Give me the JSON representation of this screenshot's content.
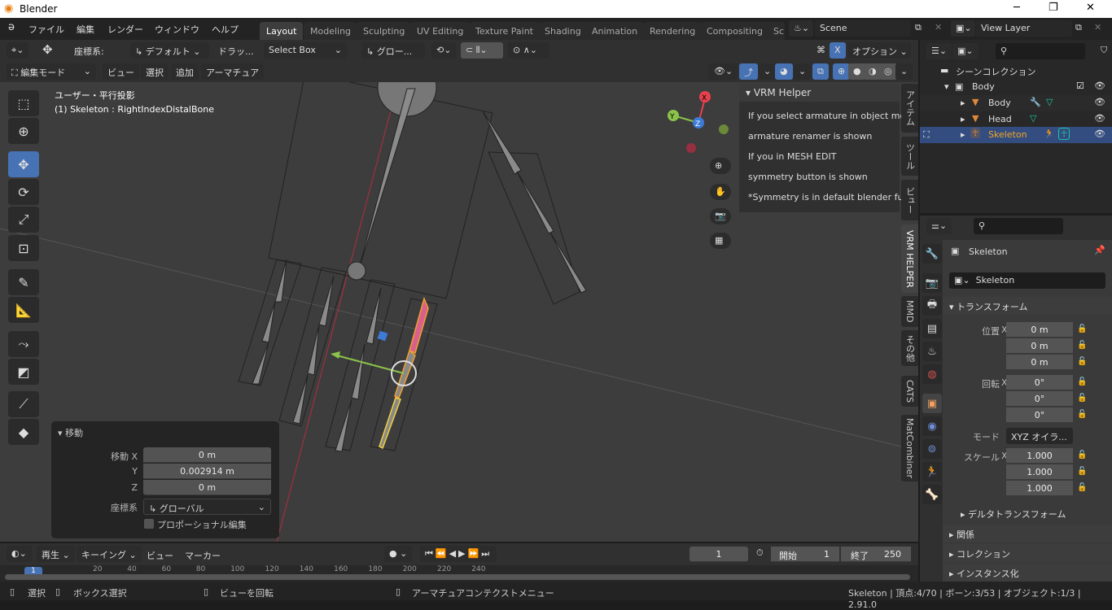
{
  "window": {
    "title": "Blender"
  },
  "menu": [
    "ファイル",
    "編集",
    "レンダー",
    "ウィンドウ",
    "ヘルプ"
  ],
  "workspaces": [
    "Layout",
    "Modeling",
    "Sculpting",
    "UV Editing",
    "Texture Paint",
    "Shading",
    "Animation",
    "Rendering",
    "Compositing",
    "Sc"
  ],
  "active_workspace": "Layout",
  "scene": "Scene",
  "view_layer": "View Layer",
  "tool_settings": {
    "coord_label": "座標系:",
    "coord_value": "デフォルト",
    "drag_label": "ドラッ...",
    "drag_value": "Select Box",
    "transform_orient": "グロー...",
    "options": "オプション",
    "mirror_x": "X"
  },
  "viewport_header": {
    "mode": "編集モード",
    "menus": [
      "ビュー",
      "選択",
      "追加",
      "アーマチュア"
    ]
  },
  "viewport": {
    "view_name": "ユーザー・平行投影",
    "object_info": "(1) Skeleton : RightIndexDistalBone",
    "gizmo_axes": [
      "X",
      "Y",
      "Z"
    ]
  },
  "vrm_helper": {
    "title": "VRM Helper",
    "lines": [
      "If you select armature in object mo...",
      "armature renamer is shown",
      "If you in MESH EDIT",
      "symmetry button is shown",
      "*Symmetry is in default blender fu..."
    ]
  },
  "n_tabs": [
    "アイテム",
    "ツール",
    "ビュー",
    "VRM HELPER",
    "MMD",
    "その他",
    "CATS",
    "MatCombiner"
  ],
  "active_n_tab": "VRM HELPER",
  "operator_panel": {
    "title": "移動",
    "fields": [
      {
        "label": "移動 X",
        "value": "0 m"
      },
      {
        "label": "Y",
        "value": "0.002914 m"
      },
      {
        "label": "Z",
        "value": "0 m"
      }
    ],
    "orient_label": "座標系",
    "orient_value": "グローバル",
    "proportional": "プロポーショナル編集",
    "proportional_checked": false
  },
  "outliner": {
    "root": "シーンコレクション",
    "items": [
      {
        "name": "Body",
        "type": "collection",
        "checked": true
      },
      {
        "name": "Body",
        "type": "mesh"
      },
      {
        "name": "Head",
        "type": "mesh"
      },
      {
        "name": "Skeleton",
        "type": "armature",
        "selected": true
      }
    ]
  },
  "properties": {
    "object_name": "Skeleton",
    "datablock": "Skeleton",
    "transform_title": "トランスフォーム",
    "location": {
      "label": "位置",
      "x": "0 m",
      "y": "0 m",
      "z": "0 m"
    },
    "rotation": {
      "label": "回転",
      "x": "0°",
      "y": "0°",
      "z": "0°"
    },
    "mode_label": "モード",
    "mode_value": "XYZ オイラ...",
    "scale": {
      "label": "スケール",
      "x": "1.000",
      "y": "1.000",
      "z": "1.000"
    },
    "axis": [
      "X",
      "Y",
      "Z"
    ],
    "sections": [
      "デルタトランスフォーム",
      "関係",
      "コレクション",
      "インスタンス化"
    ]
  },
  "timeline": {
    "menus": [
      "再生",
      "キーイング",
      "ビュー",
      "マーカー"
    ],
    "current_frame": "1",
    "start_label": "開始",
    "start": "1",
    "end_label": "終了",
    "end": "250",
    "ticks": [
      "20",
      "40",
      "60",
      "80",
      "100",
      "120",
      "140",
      "160",
      "180",
      "200",
      "220",
      "240"
    ],
    "playhead": "1"
  },
  "status": {
    "select": "選択",
    "box_select": "ボックス選択",
    "rotate_view": "ビューを回転",
    "context_menu": "アーマチュアコンテクストメニュー",
    "info": "Skeleton | 頂点:4/70 | ボーン:3/53 | オブジェクト:1/3 | 2.91.0"
  },
  "colors": {
    "accent": "#4772b3",
    "selected_bone": "#f0a030",
    "x_axis": "#e8414e",
    "y_axis": "#8bc34a",
    "z_axis": "#3d7bd6"
  }
}
